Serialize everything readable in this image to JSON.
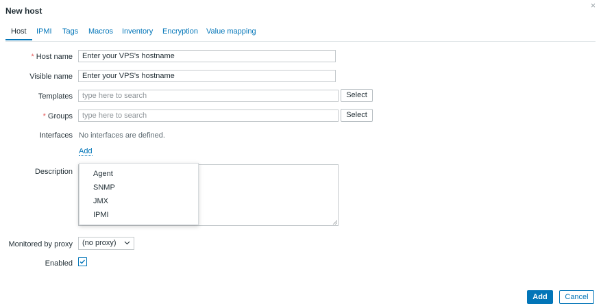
{
  "dialog": {
    "title": "New host",
    "close_glyph": "×"
  },
  "tabs": [
    {
      "label": "Host",
      "active": true
    },
    {
      "label": "IPMI"
    },
    {
      "label": "Tags"
    },
    {
      "label": "Macros"
    },
    {
      "label": "Inventory"
    },
    {
      "label": "Encryption"
    },
    {
      "label": "Value mapping"
    }
  ],
  "form": {
    "host_name": {
      "label": "Host name",
      "required": "*",
      "value": "Enter your VPS's hostname"
    },
    "visible_name": {
      "label": "Visible name",
      "value": "Enter your VPS's hostname"
    },
    "templates": {
      "label": "Templates",
      "placeholder": "type here to search",
      "button": "Select"
    },
    "groups": {
      "label": "Groups",
      "required": "*",
      "placeholder": "type here to search",
      "button": "Select"
    },
    "interfaces": {
      "label": "Interfaces",
      "text": "No interfaces are defined.",
      "add_link": "Add"
    },
    "description": {
      "label": "Description"
    },
    "proxy": {
      "label": "Monitored by proxy",
      "selected": "(no proxy)"
    },
    "enabled": {
      "label": "Enabled",
      "checked": true
    }
  },
  "interface_menu": {
    "items": [
      "Agent",
      "SNMP",
      "JMX",
      "IPMI"
    ]
  },
  "footer": {
    "add_label": "Add",
    "cancel_label": "Cancel"
  },
  "icons": {
    "close": "close-icon",
    "chevron": "chevron-down-icon",
    "check": "checkmark-icon"
  },
  "colors": {
    "accent": "#0275b8",
    "required": "#e45959",
    "text": "#1f2c33",
    "border": "#c4c9cc"
  }
}
